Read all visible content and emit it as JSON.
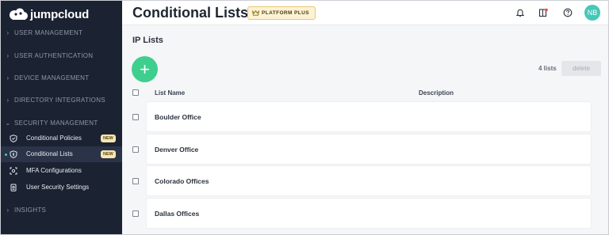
{
  "brand": {
    "name": "jumpcloud"
  },
  "sidebar": {
    "sections": [
      {
        "label": "USER MANAGEMENT"
      },
      {
        "label": "USER AUTHENTICATION"
      },
      {
        "label": "DEVICE MANAGEMENT"
      },
      {
        "label": "DIRECTORY INTEGRATIONS"
      },
      {
        "label": "SECURITY MANAGEMENT"
      },
      {
        "label": "INSIGHTS"
      }
    ],
    "items": [
      {
        "label": "Conditional Policies",
        "badge": "NEW",
        "icon": "shield-icon"
      },
      {
        "label": "Conditional Lists",
        "badge": "NEW",
        "icon": "list-shield-icon",
        "active": true
      },
      {
        "label": "MFA Configurations",
        "icon": "scan-icon"
      },
      {
        "label": "User Security Settings",
        "icon": "lock-icon"
      }
    ]
  },
  "header": {
    "title": "Conditional Lists",
    "badge": "PLATFORM PLUS",
    "avatar_initials": "NB"
  },
  "main": {
    "section_title": "IP Lists",
    "add_label": "+",
    "count_label": "4 lists",
    "delete_label": "delete",
    "columns": {
      "name": "List Name",
      "description": "Description"
    },
    "rows": [
      {
        "name": "Boulder Office",
        "description": ""
      },
      {
        "name": "Denver Office",
        "description": ""
      },
      {
        "name": "Colorado Offices",
        "description": ""
      },
      {
        "name": "Dallas Offices",
        "description": ""
      }
    ]
  },
  "colors": {
    "sidebar_bg": "#1b2232",
    "accent_green": "#3ecf8e",
    "avatar_teal": "#47c7b8",
    "badge_yellow": "#fcf2d5"
  }
}
